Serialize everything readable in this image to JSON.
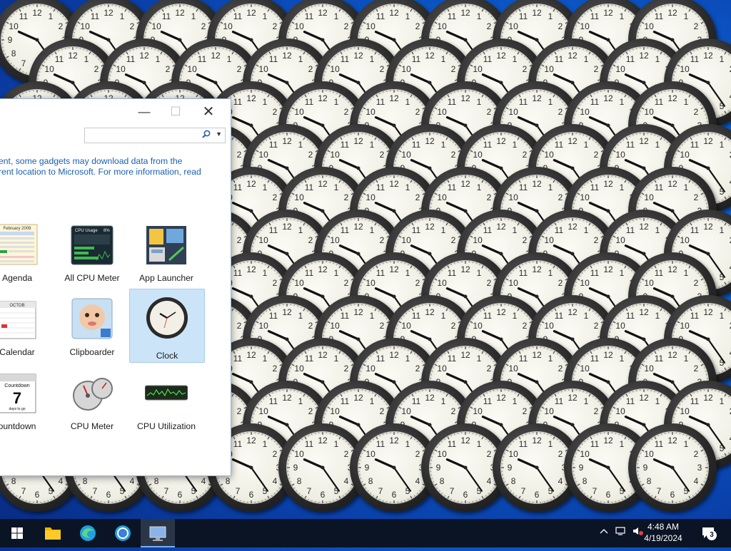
{
  "window": {
    "minimize_glyph": "—",
    "maximize_glyph": "☐",
    "close_glyph": "✕",
    "search_placeholder": "",
    "notice_line1": "ent, some gadgets may download data from the",
    "notice_line2": "rent location to Microsoft. For more information, read"
  },
  "gadgets": [
    {
      "label": "Agenda",
      "icon": "agenda-icon"
    },
    {
      "label": "All CPU Meter",
      "icon": "cpu-meter-icon"
    },
    {
      "label": "App Launcher",
      "icon": "app-launcher-icon"
    },
    {
      "label": "Calendar",
      "icon": "calendar-icon"
    },
    {
      "label": "Clipboarder",
      "icon": "clipboarder-icon"
    },
    {
      "label": "Clock",
      "icon": "clock-icon",
      "selected": true
    },
    {
      "label": "ountdown",
      "icon": "countdown-icon"
    },
    {
      "label": "CPU Meter",
      "icon": "cpu-gauge-icon"
    },
    {
      "label": "CPU Utilization",
      "icon": "cpu-utilization-icon"
    }
  ],
  "thumb_text": {
    "agenda_month": "February 2009",
    "cpu_title": "CPU Usage",
    "cpu_pct": "8%",
    "calendar_month": "OCTOB",
    "countdown_title": "Countdown",
    "countdown_num": "7",
    "countdown_sub": "days to go"
  },
  "taskbar": {
    "time": "4:48 AM",
    "date": "4/19/2024",
    "notification_count": "3"
  },
  "colors": {
    "accent": "#1a5fb4",
    "selection": "#cce4f7"
  }
}
